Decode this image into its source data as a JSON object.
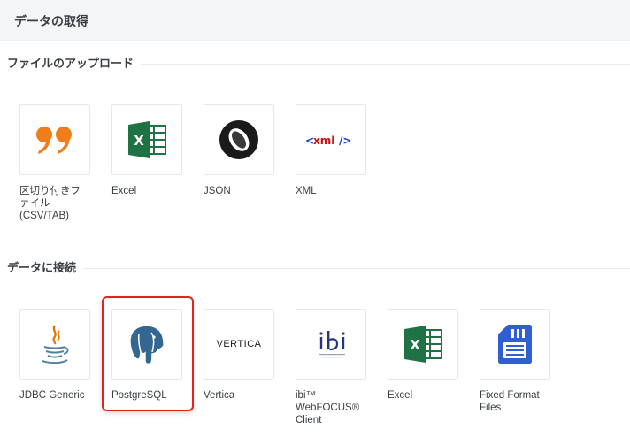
{
  "header": {
    "title": "データの取得"
  },
  "sections": {
    "upload": {
      "title": "ファイルのアップロード",
      "items": [
        {
          "label": "区切り付きフ\nァイル\n(CSV/TAB)",
          "icon": "quote-icon"
        },
        {
          "label": "Excel",
          "icon": "excel-icon"
        },
        {
          "label": "JSON",
          "icon": "json-icon"
        },
        {
          "label": "XML",
          "icon": "xml-icon"
        }
      ]
    },
    "connect": {
      "title": "データに接続",
      "items": [
        {
          "label": "JDBC Generic",
          "icon": "java-icon"
        },
        {
          "label": "PostgreSQL",
          "icon": "postgresql-elephant-icon",
          "selected": true
        },
        {
          "label": "Vertica",
          "icon": "vertica-logo-icon"
        },
        {
          "label": "ibi™\nWebFOCUS®\nClient",
          "icon": "ibi-logo-icon"
        },
        {
          "label": "Excel",
          "icon": "excel-icon"
        },
        {
          "label": "Fixed Format\nFiles",
          "icon": "sd-card-icon"
        }
      ]
    }
  },
  "logo_text": {
    "xml": "<xml />",
    "vertica": "VERTICA",
    "ibi": "ibi"
  },
  "colors": {
    "accent_orange": "#f07d1a",
    "excel_green": "#1f7244",
    "xml_red": "#cc1111",
    "xml_blue": "#1144cc",
    "postgres_blue": "#336791",
    "fixed_blue": "#2f5fd0",
    "selection_red": "#e02424"
  }
}
